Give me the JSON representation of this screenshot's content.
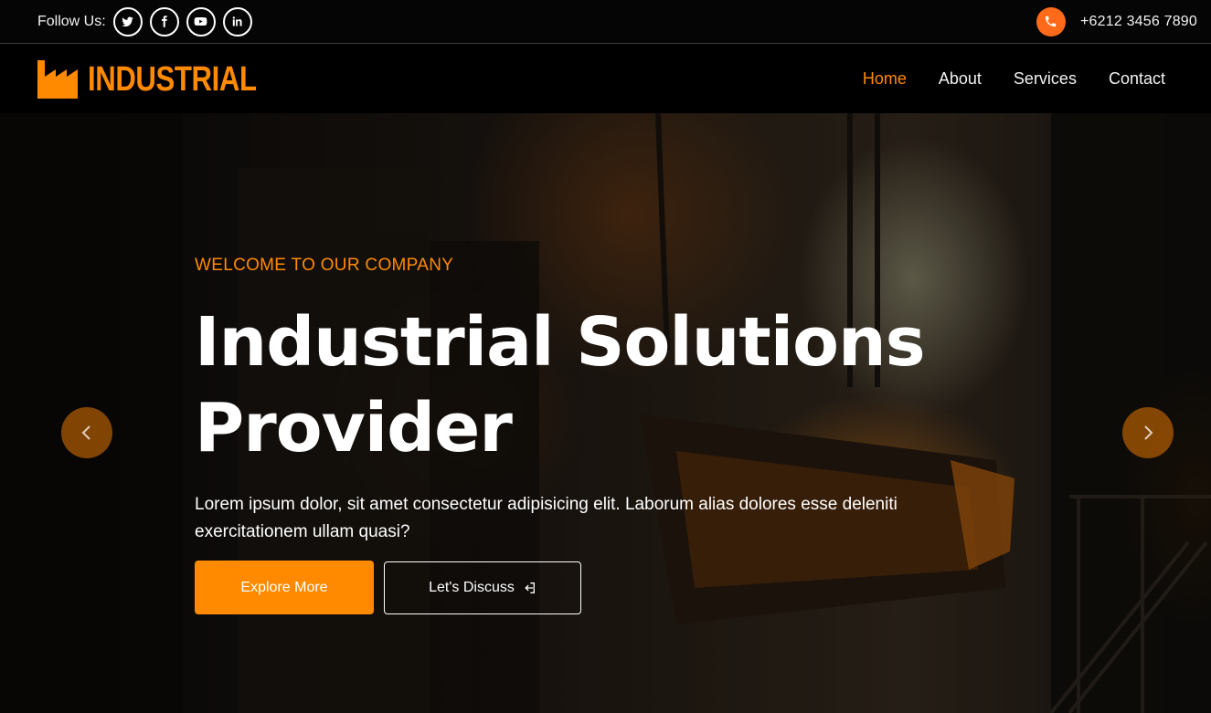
{
  "topbar": {
    "follow_label": "Follow Us:",
    "socials": [
      "twitter-icon",
      "facebook-icon",
      "youtube-icon",
      "linkedin-icon"
    ],
    "phone": "+6212 3456 7890",
    "phone_icon_color": "#ff6a1a"
  },
  "navbar": {
    "brand": "INDUSTRIAL",
    "brand_color": "#ff8a00",
    "items": [
      {
        "label": "Home",
        "active": true
      },
      {
        "label": "About",
        "active": false
      },
      {
        "label": "Services",
        "active": false
      },
      {
        "label": "Contact",
        "active": false
      }
    ]
  },
  "hero": {
    "eyebrow": "WELCOME TO OUR COMPANY",
    "headline_line1": "Industrial Solutions",
    "headline_line2": "Provider",
    "lead": "Lorem ipsum dolor, sit amet consectetur adipisicing elit. Laborum alias dolores esse deleniti exercitationem ullam quasi?",
    "primary_button": "Explore More",
    "secondary_button": "Let's Discuss",
    "accent_color": "#ff8a00"
  }
}
